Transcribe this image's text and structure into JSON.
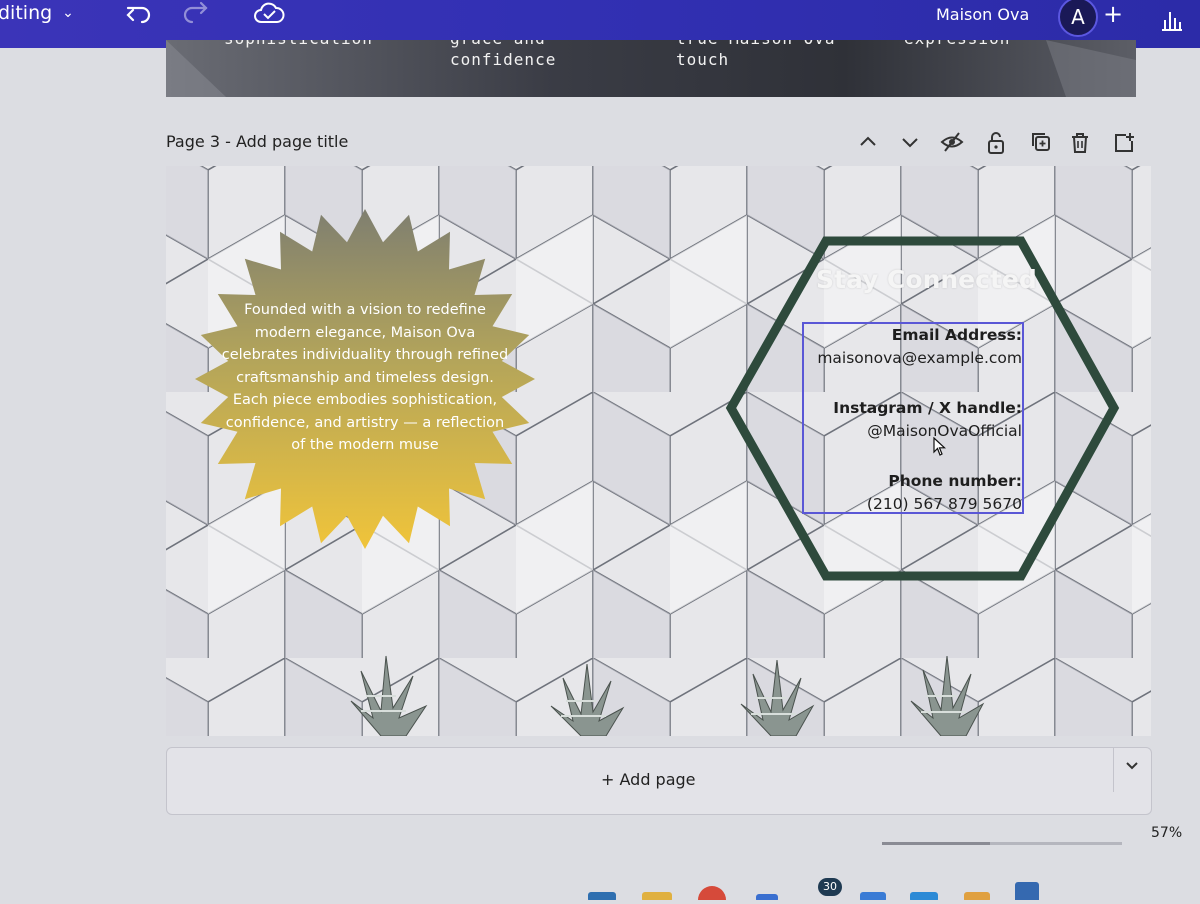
{
  "topbar": {
    "mode_label": "diting",
    "doc_title": "Maison Ova",
    "avatar_letter": "A",
    "plus_label": "+"
  },
  "page2": {
    "snippets": [
      "sophistication",
      "grace and\nconfidence",
      "true Maison Ova\ntouch",
      "expression"
    ]
  },
  "page3": {
    "title": "Page 3 - Add page title",
    "about_text": "Founded with a vision to redefine modern elegance, Maison Ova celebrates individuality through refined craftsmanship and timeless design. Each piece embodies sophistication, confidence, and artistry — a reflection of the modern muse",
    "stay_heading": "Stay Connected",
    "email_label": "Email Address:",
    "email_value": "maisonova@example.com",
    "social_label": "Instagram / X handle:",
    "social_value": "@MaisonOvaOfficial",
    "phone_label": "Phone number:",
    "phone_value": "(210) 567 879 5670"
  },
  "footer": {
    "add_page_label": "+ Add page",
    "zoom_label": "57%",
    "zoom_value": 57,
    "notification_count": "30"
  },
  "colors": {
    "topbar": "#3230b3",
    "hexagon_frame": "#2e4a3c",
    "selection": "#5a57d6",
    "burst_top": "#7f7f70",
    "burst_bottom": "#f0c43a"
  },
  "icons": [
    "chevron-down-icon",
    "undo-icon",
    "redo-icon",
    "cloud-saved-icon",
    "stats-icon",
    "chevron-up-icon",
    "hide-icon",
    "lock-icon",
    "duplicate-icon",
    "trash-icon",
    "add-page-icon"
  ]
}
